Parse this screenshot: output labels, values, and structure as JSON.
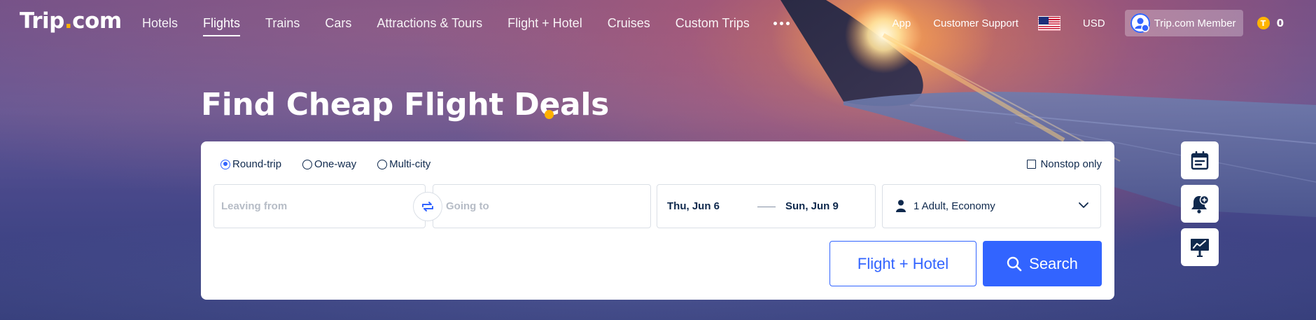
{
  "brand": {
    "logo_main": "Trip",
    "logo_dot": ".",
    "logo_tail": "com"
  },
  "nav": {
    "items": [
      {
        "label": "Hotels",
        "active": false
      },
      {
        "label": "Flights",
        "active": true
      },
      {
        "label": "Trains",
        "active": false
      },
      {
        "label": "Cars",
        "active": false
      },
      {
        "label": "Attractions & Tours",
        "active": false
      },
      {
        "label": "Flight + Hotel",
        "active": false
      },
      {
        "label": "Cruises",
        "active": false
      },
      {
        "label": "Custom Trips",
        "active": false
      }
    ],
    "more_icon": "more-dots-icon"
  },
  "nav_right": {
    "app": "App",
    "support": "Customer Support",
    "flag_icon": "us-flag-icon",
    "currency": "USD",
    "member": "Trip.com Member",
    "coin_symbol": "T",
    "coins": "0"
  },
  "hero": {
    "title": "Find Cheap Flight Deals"
  },
  "search": {
    "trip_types": [
      {
        "label": "Round-trip",
        "selected": true
      },
      {
        "label": "One-way",
        "selected": false
      },
      {
        "label": "Multi-city",
        "selected": false
      }
    ],
    "nonstop_label": "Nonstop only",
    "from_placeholder": "Leaving from",
    "to_placeholder": "Going to",
    "depart_date": "Thu, Jun 6",
    "return_date": "Sun, Jun 9",
    "passengers": "1 Adult, Economy",
    "flight_hotel_label": "Flight + Hotel",
    "search_label": "Search"
  },
  "side_tools": [
    "calendar-icon",
    "price-alert-bell-icon",
    "price-trend-icon"
  ],
  "colors": {
    "accent": "#3264ff",
    "brand_dot": "#ffb100",
    "text_dark": "#0f294d",
    "placeholder": "#b6bcc6"
  }
}
